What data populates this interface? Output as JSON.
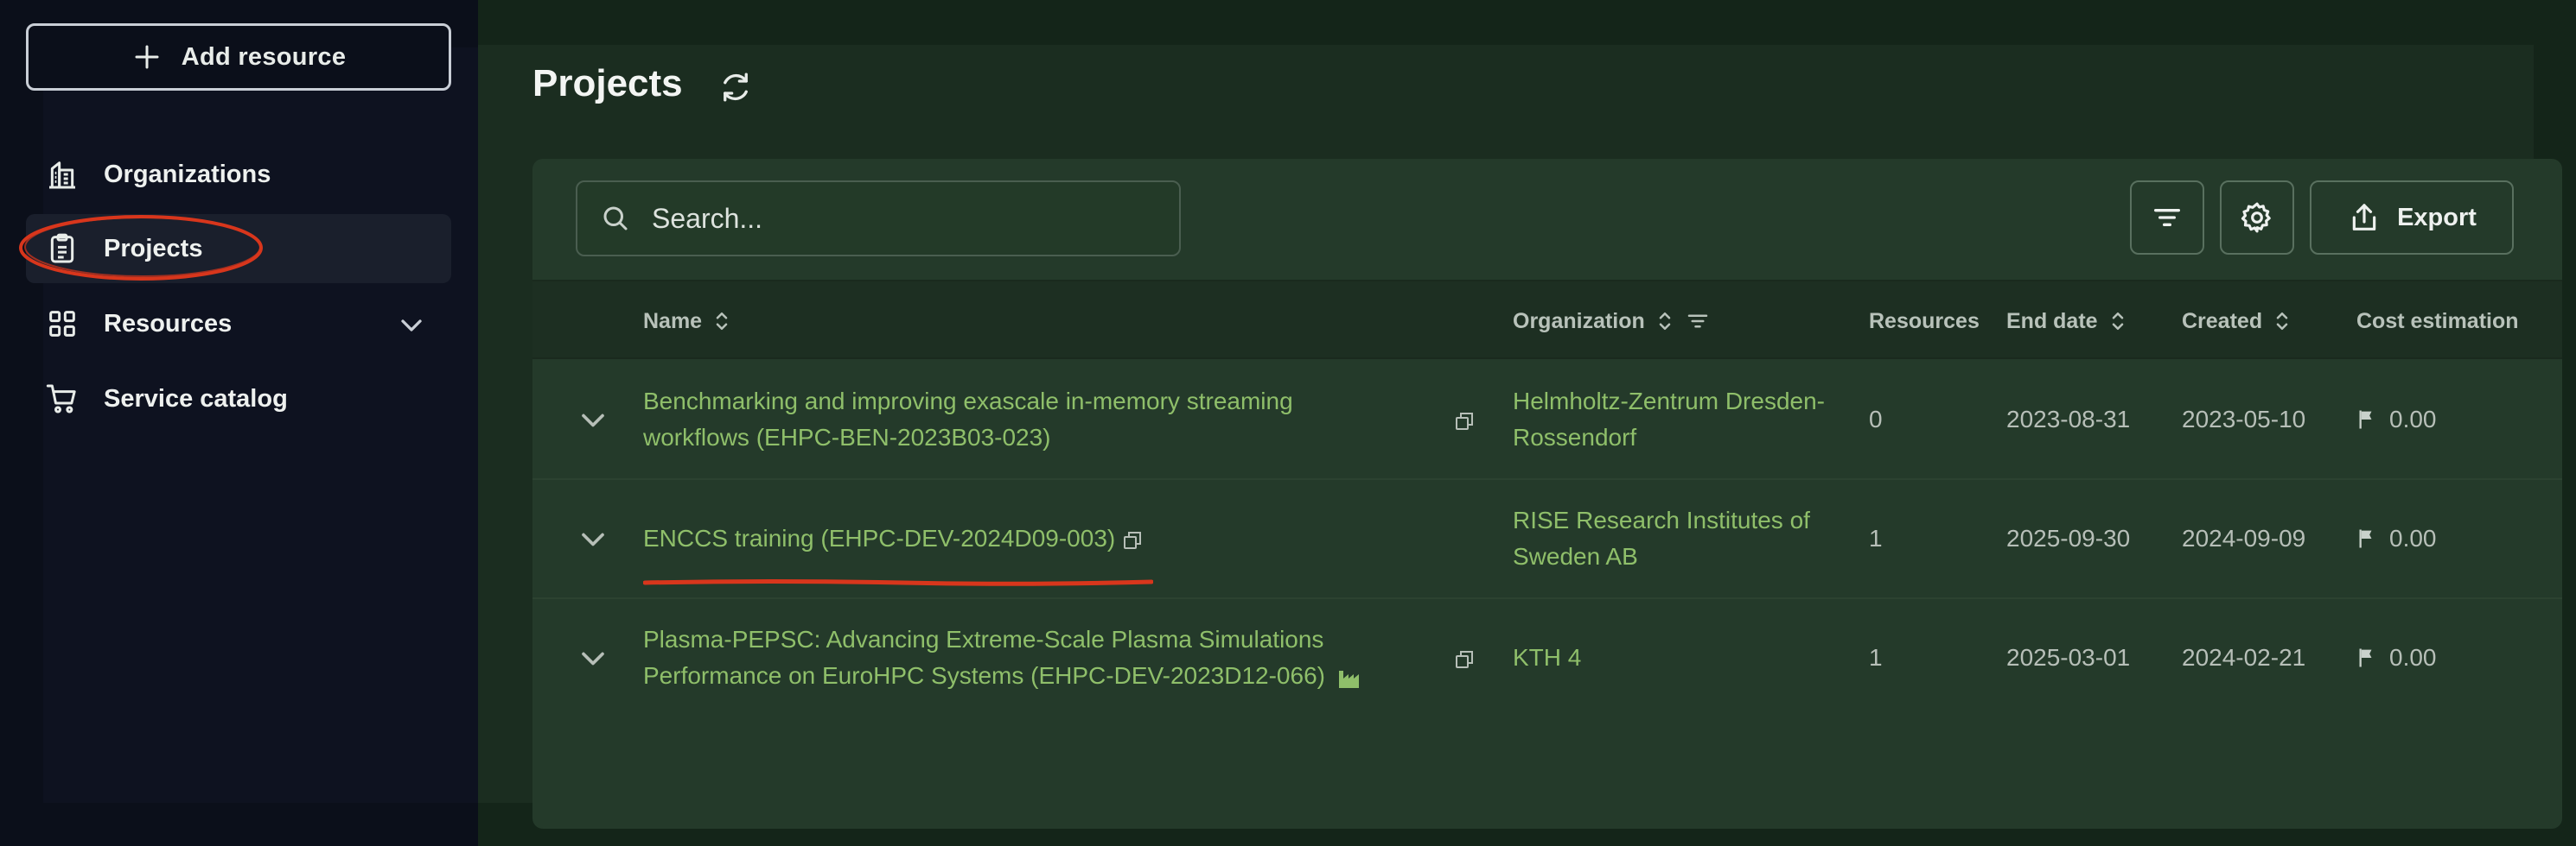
{
  "sidebar": {
    "add_resource_label": "Add resource",
    "items": [
      {
        "label": "Organizations",
        "icon": "building-icon"
      },
      {
        "label": "Projects",
        "icon": "clipboard-icon",
        "active": true
      },
      {
        "label": "Resources",
        "icon": "grid-icon",
        "expandable": true
      },
      {
        "label": "Service catalog",
        "icon": "cart-icon"
      }
    ]
  },
  "page": {
    "title": "Projects"
  },
  "toolbar": {
    "search_placeholder": "Search...",
    "export_label": "Export"
  },
  "table": {
    "columns": [
      "Name",
      "Organization",
      "Resources",
      "End date",
      "Created",
      "Cost estimation"
    ],
    "rows": [
      {
        "name": "Benchmarking and improving exascale in-memory streaming workflows (EHPC-BEN-2023B03-023)",
        "organization": "Helmholtz-Zentrum Dresden-Rossendorf",
        "resources": "0",
        "end_date": "2023-08-31",
        "created": "2023-05-10",
        "cost": "0.00"
      },
      {
        "name": "ENCCS training (EHPC-DEV-2024D09-003)",
        "organization": "RISE Research Institutes of Sweden AB",
        "resources": "1",
        "end_date": "2025-09-30",
        "created": "2024-09-09",
        "cost": "0.00"
      },
      {
        "name": "Plasma-PEPSC: Advancing Extreme-Scale Plasma Simulations Performance on EuroHPC Systems (EHPC-DEV-2023D12-066)",
        "organization": "KTH 4",
        "resources": "1",
        "end_date": "2025-03-01",
        "created": "2024-02-21",
        "cost": "0.00"
      }
    ]
  },
  "colors": {
    "accent_link": "#8fbf6a",
    "annotation": "#d8361c",
    "sidebar_bg": "#0b0f1a",
    "main_bg": "#142519"
  }
}
